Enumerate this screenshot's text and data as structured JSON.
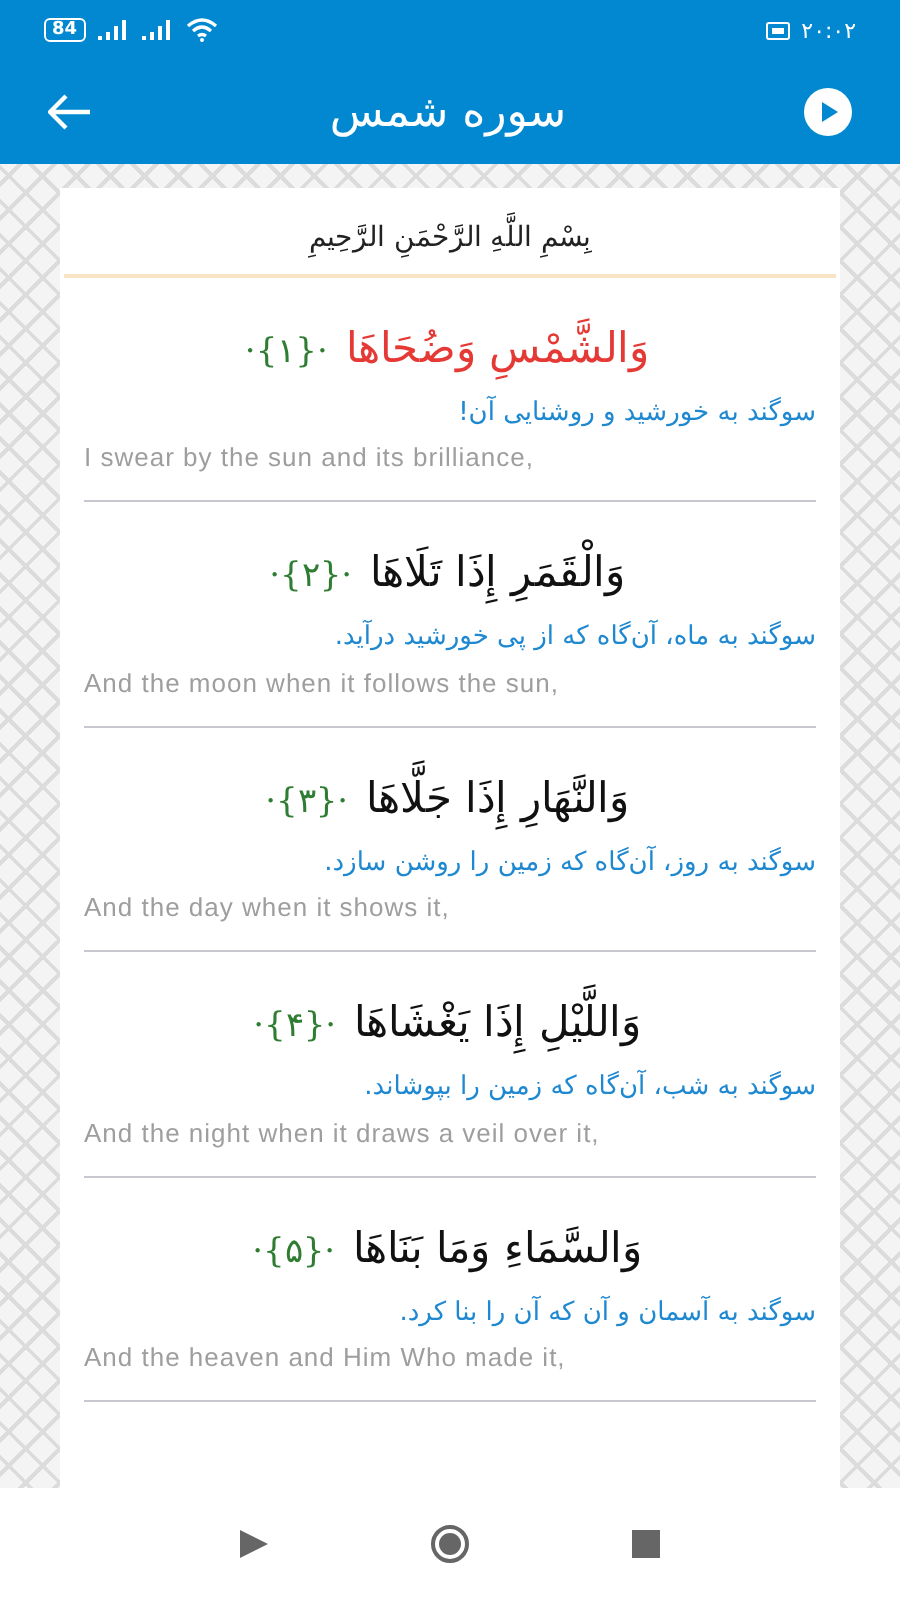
{
  "status_bar": {
    "battery": "84",
    "time": "۲۰:۰۲"
  },
  "app_bar": {
    "title": "سوره شمس"
  },
  "bismillah": "بِسْمِ اللَّهِ الرَّحْمَنِ الرَّحِيمِ",
  "verses": [
    {
      "arabic": "وَالشَّمْسِ وَضُحَاهَا",
      "number": "·{۱}·",
      "persian": "سوگند به خورشید و روشنایی آن!",
      "english": "I swear by the sun and its brilliance,",
      "selected": true
    },
    {
      "arabic": "وَالْقَمَرِ إِذَا تَلَاهَا",
      "number": "·{۲}·",
      "persian": "سوگند به ماه، آن‌گاه که از پی خورشید درآید.",
      "english": "And the moon when it follows the sun,",
      "selected": false
    },
    {
      "arabic": "وَالنَّهَارِ إِذَا جَلَّاهَا",
      "number": "·{۳}·",
      "persian": "سوگند به روز، آن‌گاه که زمین را روشن سازد.",
      "english": "And the day when it shows it,",
      "selected": false
    },
    {
      "arabic": "وَاللَّيْلِ إِذَا يَغْشَاهَا",
      "number": "·{۴}·",
      "persian": "سوگند به شب، آن‌گاه که زمین را بپوشاند.",
      "english": "And the night when it draws a veil over it,",
      "selected": false
    },
    {
      "arabic": "وَالسَّمَاءِ وَمَا بَنَاهَا",
      "number": "·{۵}·",
      "persian": "سوگند به آسمان و آن که آن را بنا کرد.",
      "english": "And the heaven and Him Who made it,",
      "selected": false
    }
  ]
}
